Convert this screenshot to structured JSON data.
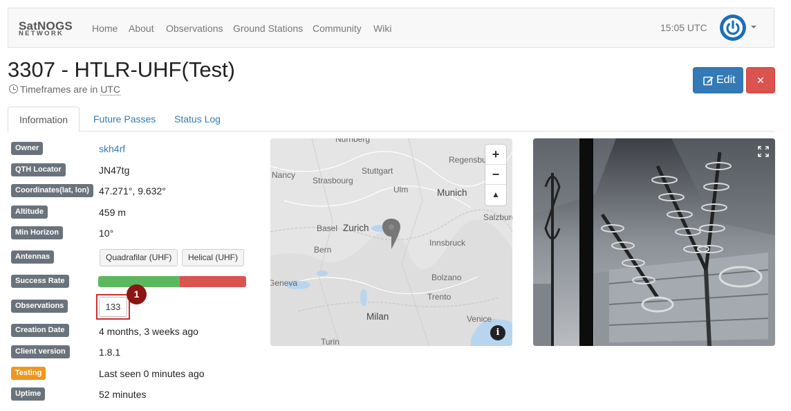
{
  "navbar": {
    "brand_top": "SatNOGS",
    "brand_bottom": "NETWORK",
    "items": [
      "Home",
      "About",
      "Observations",
      "Ground Stations",
      "Community",
      "Wiki"
    ],
    "time": "15:05 UTC",
    "user_icon": "power-icon"
  },
  "station": {
    "title": "3307 - HTLR-UHF(Test)",
    "subtitle_prefix": "Timeframes are in",
    "timezone": "UTC",
    "edit_label": "Edit",
    "delete_label": "✕"
  },
  "tabs": [
    "Information",
    "Future Passes",
    "Status Log"
  ],
  "info": {
    "owner": {
      "label": "Owner",
      "value": "skh4rf"
    },
    "qth": {
      "label": "QTH Locator",
      "value": "JN47tg"
    },
    "coords": {
      "label": "Coordinates(lat, lon)",
      "value": "47.271°, 9.632°"
    },
    "altitude": {
      "label": "Altitude",
      "value": "459 m"
    },
    "min_horizon": {
      "label": "Min Horizon",
      "value": "10°"
    },
    "antennas": {
      "label": "Antennas",
      "items": [
        "Quadrafilar (UHF)",
        "Helical (UHF)"
      ]
    },
    "success_rate": {
      "label": "Success Rate",
      "good_fraction": 0.55,
      "good_color": "#5cb85c",
      "bad_color": "#d9534f"
    },
    "observations": {
      "label": "Observations",
      "value": "133",
      "marker": "1"
    },
    "creation_date": {
      "label": "Creation Date",
      "value": "4 months, 3 weeks ago"
    },
    "client_version": {
      "label": "Client version",
      "value": "1.8.1"
    },
    "status": {
      "label": "Testing",
      "value": "Last seen 0 minutes ago"
    },
    "uptime": {
      "label": "Uptime",
      "value": "52 minutes"
    }
  },
  "map": {
    "labels": [
      "Nürnberg",
      "Regensburg",
      "Stuttgart",
      "Nancy",
      "Strasbourg",
      "Ulm",
      "Munich",
      "Salzburg",
      "Basel",
      "Zurich",
      "Innsbruck",
      "Bern",
      "Geneva",
      "Bolzano",
      "Trento",
      "Milan",
      "Venice",
      "Turin"
    ],
    "zoom_in": "+",
    "zoom_out": "−",
    "compass": "▲",
    "info": "i"
  }
}
